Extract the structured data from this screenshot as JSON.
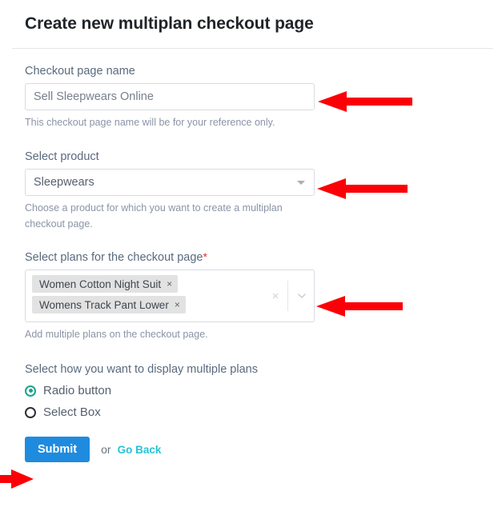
{
  "header": {
    "title": "Create new multiplan checkout page"
  },
  "form": {
    "name_field": {
      "label": "Checkout page name",
      "value": "Sell Sleepwears Online",
      "placeholder": "Sell Sleepwears Online",
      "help": "This checkout page name will be for your reference only."
    },
    "product_field": {
      "label": "Select product",
      "selected": "Sleepwears",
      "help_line1": "Choose a product for which you want to create a multiplan",
      "help_line2": "checkout page.",
      "caret_icon": "caret-down-icon"
    },
    "plans_field": {
      "label": "Select plans for the checkout page",
      "required_mark": "*",
      "tags": [
        {
          "label": "Women Cotton Night Suit",
          "remove_icon": "×"
        },
        {
          "label": "Womens Track Pant Lower",
          "remove_icon": "×"
        }
      ],
      "clear_icon": "×",
      "chevron_icon": "chevron-down-icon",
      "help": "Add multiple plans on the checkout page."
    },
    "display_mode": {
      "heading": "Select how you want to display multiple plans",
      "options": [
        {
          "label": "Radio button",
          "selected": true
        },
        {
          "label": "Select Box",
          "selected": false
        }
      ]
    }
  },
  "footer": {
    "submit_label": "Submit",
    "or_label": "or",
    "goback_label": "Go Back"
  },
  "colors": {
    "accent_blue": "#1e8bdf",
    "link_cyan": "#25c3d6",
    "radio_green": "#18a689",
    "required_red": "#e03131",
    "arrow_red": "#fb0007"
  },
  "annotations": [
    {
      "name": "arrow-to-name-input",
      "direction": "left"
    },
    {
      "name": "arrow-to-product-select",
      "direction": "left"
    },
    {
      "name": "arrow-to-plans-select",
      "direction": "left"
    },
    {
      "name": "arrow-to-submit-button",
      "direction": "right"
    }
  ]
}
